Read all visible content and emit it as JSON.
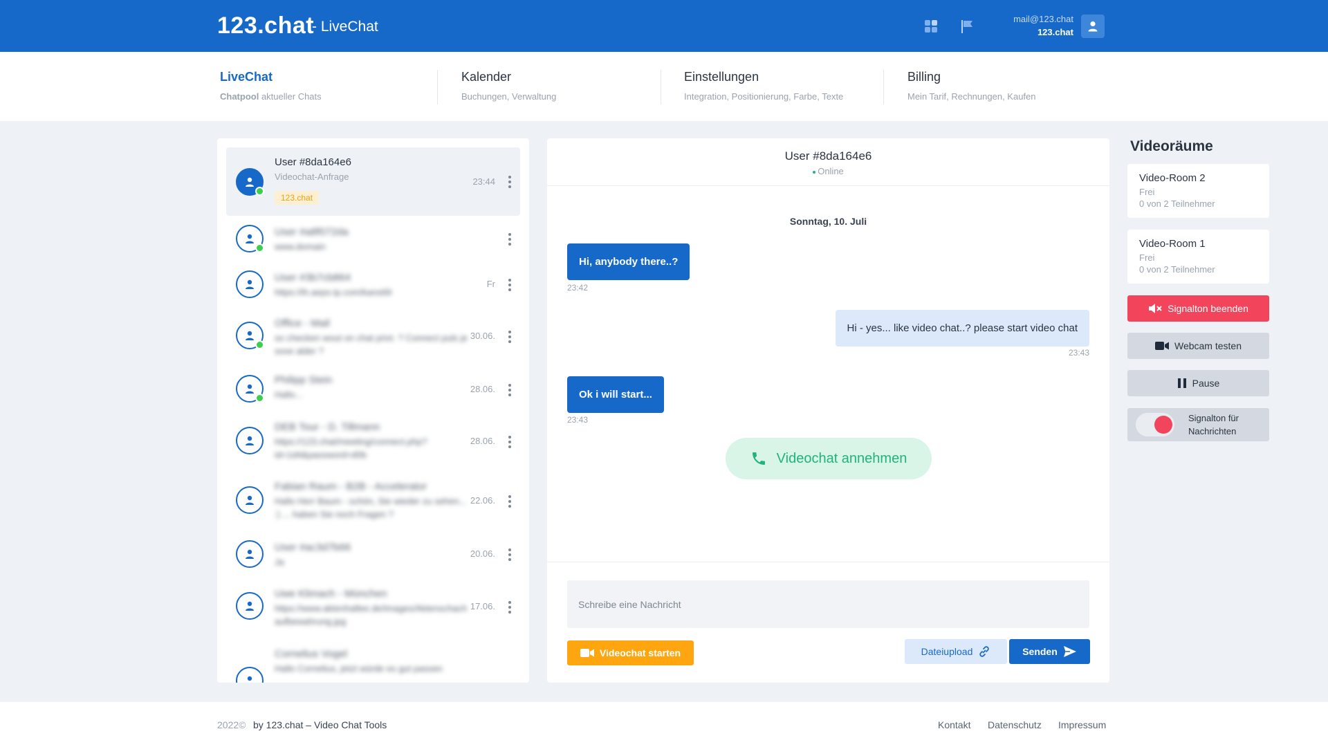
{
  "header": {
    "logo": "123.chat",
    "logo_suffix": "- LiveChat",
    "user_email": "mail@123.chat",
    "user_org": "123.chat",
    "icons": [
      "grid-icon",
      "flag-icon",
      "user-icon"
    ]
  },
  "nav": [
    {
      "title": "LiveChat",
      "sub_bold": "Chatpool",
      "sub": " aktueller Chats",
      "active": true
    },
    {
      "title": "Kalender",
      "sub": "Buchungen, Verwaltung"
    },
    {
      "title": "Einstellungen",
      "sub": "Integration, Positionierung, Farbe, Texte"
    },
    {
      "title": "Billing",
      "sub": "Mein Tarif, Rechnungen, Kaufen"
    }
  ],
  "chats": [
    {
      "name": "User #8da164e6",
      "sub": "Videochat-Anfrage",
      "tag": "123.chat",
      "date": "23:44",
      "online": true,
      "selected": true
    },
    {
      "name": "User #a8f072da",
      "sub": "www.domain",
      "date": "",
      "online": true
    },
    {
      "name": "User #3b7cb864",
      "sub": "https://ih.aeps-ip.com/kans69",
      "date": "Fr",
      "online": false
    },
    {
      "name": "Office - Mail",
      "sub": "so checken wout on chat privt. ? Connect puls je sove alder ?",
      "date": "30.06.",
      "online": true
    },
    {
      "name": "Philipp Stein",
      "sub": "Hallo...",
      "date": "28.06.",
      "online": true
    },
    {
      "name": "DEB Tour - D. Tillmann",
      "sub": "https://123.chat/meeting/connect.php? id=1d4&password=d0b",
      "date": "28.06.",
      "online": false
    },
    {
      "name": "Fabian Raum - B2B - Accelerator",
      "sub": "Hallo Herr Baum - schön, Sie wieder zu sehen... :) ... haben Sie noch Fragen ?",
      "date": "22.06.",
      "online": false
    },
    {
      "name": "User #ac3d7b66",
      "sub": "Ja",
      "date": "20.06.",
      "online": false
    },
    {
      "name": "Uwe Klimach - München",
      "sub": "https://www.aktenhallee.de/images/Aktenschachaufbewahrung.jpg",
      "date": "17.06.",
      "online": false
    },
    {
      "name": "Cornelius Vogel",
      "sub": "Hallo Cornelius, jetzt würde es gut passen",
      "date": "",
      "online": false
    }
  ],
  "conversation": {
    "title": "User #8da164e6",
    "status": "Online",
    "date_label": "Sonntag, 10. Juli",
    "messages": [
      {
        "text": "Hi, anybody there..?",
        "time": "23:42",
        "dir": "in"
      },
      {
        "text": "Hi - yes... like video chat..? please start video chat",
        "time": "23:43",
        "dir": "out"
      },
      {
        "text": "Ok i will start...",
        "time": "23:43",
        "dir": "in"
      }
    ],
    "accept_label": "Videochat annehmen",
    "input_placeholder": "Schreibe eine Nachricht",
    "video_start_label": "Videochat starten",
    "upload_label": "Dateiupload",
    "send_label": "Senden"
  },
  "rooms": {
    "title": "Videoräume",
    "items": [
      {
        "name": "Video-Room 2",
        "status": "Frei",
        "participants": "0 von 2 Teilnehmer"
      },
      {
        "name": "Video-Room 1",
        "status": "Frei",
        "participants": "0 von 2 Teilnehmer"
      }
    ],
    "stop_signal_label": "Signalton beenden",
    "webcam_test_label": "Webcam testen",
    "pause_label": "Pause",
    "signal_messages_label_1": "Signalton für",
    "signal_messages_label_2": "Nachrichten"
  },
  "footer": {
    "copyright": "2022©",
    "by": "by 123.chat – Video Chat Tools",
    "links": [
      "Kontakt",
      "Datenschutz",
      "Impressum"
    ]
  },
  "colors": {
    "primary": "#1769c9",
    "accent_orange": "#ffa50f",
    "danger": "#f2445a",
    "online": "#3ccf4e",
    "accept_green": "#22b37c"
  }
}
